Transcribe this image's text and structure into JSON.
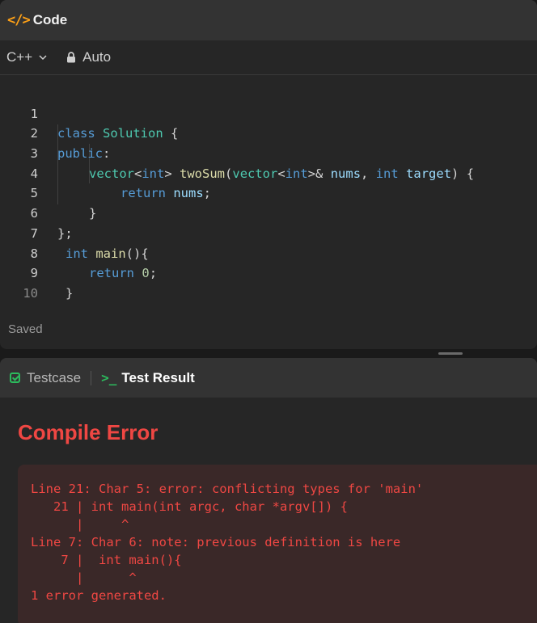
{
  "code_panel": {
    "icon": "code-brackets-icon",
    "icon_text": "</>",
    "title": "Code",
    "language": "C++",
    "mode": "Auto",
    "status": "Saved"
  },
  "code_lines": [
    {
      "n": "1"
    },
    {
      "n": "2"
    },
    {
      "n": "3"
    },
    {
      "n": "4"
    },
    {
      "n": "5"
    },
    {
      "n": "6"
    },
    {
      "n": "7"
    },
    {
      "n": "8"
    },
    {
      "n": "9"
    },
    {
      "n": "10"
    }
  ],
  "code_tokens": {
    "l1": [
      "class",
      " ",
      "Solution",
      " {"
    ],
    "l2": [
      "public",
      ":"
    ],
    "l3": [
      "vector",
      "<",
      "int",
      "> ",
      "twoSum",
      "(",
      "vector",
      "<",
      "int",
      ">& ",
      "nums",
      ", ",
      "int",
      " ",
      "target",
      ") {"
    ],
    "l4": [
      "return",
      " ",
      "nums",
      ";"
    ],
    "l5": [
      "}"
    ],
    "l6": [
      "};"
    ],
    "l7": [
      "int",
      " ",
      "main",
      "(){"
    ],
    "l8": [
      "return",
      " ",
      "0",
      ";"
    ],
    "l9": [
      "}"
    ]
  },
  "result_panel": {
    "tab_testcase": "Testcase",
    "tab_result": "Test Result",
    "term_icon_text": ">_",
    "status": "Compile Error",
    "error_lines": [
      "Line 21: Char 5: error: conflicting types for 'main'",
      "   21 | int main(int argc, char *argv[]) {",
      "      |     ^",
      "Line 7: Char 6: note: previous definition is here",
      "    7 |  int main(){",
      "      |      ^",
      "1 error generated."
    ]
  },
  "colors": {
    "accent": "#ffa116",
    "success": "#2cbb5d",
    "error": "#ef4743"
  }
}
